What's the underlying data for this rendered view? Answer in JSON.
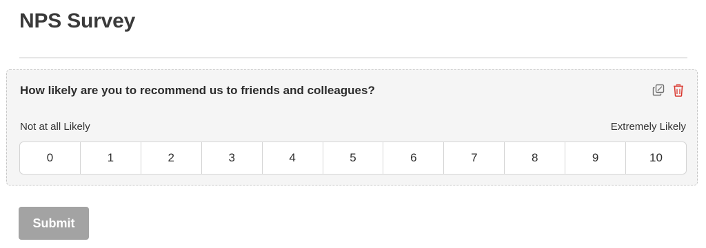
{
  "page": {
    "title": "NPS Survey"
  },
  "question": {
    "text": "How likely are you to recommend us to friends and colleagues?",
    "low_label": "Not at all Likely",
    "high_label": "Extremely Likely",
    "options": [
      "0",
      "1",
      "2",
      "3",
      "4",
      "5",
      "6",
      "7",
      "8",
      "9",
      "10"
    ],
    "actions": [
      {
        "icon": "duplicate-icon",
        "color": "#6f6f6f"
      },
      {
        "icon": "trash-icon",
        "color": "#d9342b"
      }
    ]
  },
  "submit": {
    "label": "Submit",
    "color": "#a3a3a3"
  }
}
